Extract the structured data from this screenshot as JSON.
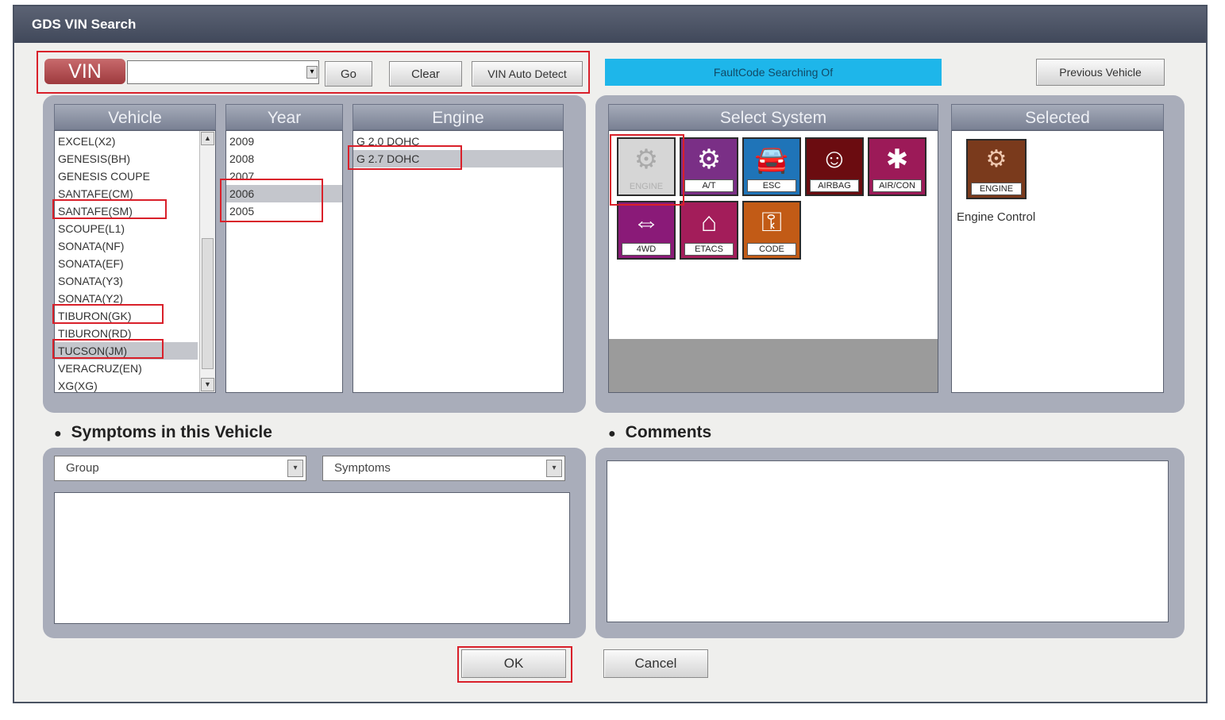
{
  "window": {
    "title": "GDS VIN Search"
  },
  "toolbar": {
    "vin_label": "VIN",
    "vin_input_value": "",
    "go_label": "Go",
    "clear_label": "Clear",
    "auto_detect_label": "VIN Auto Detect",
    "fault_status": "FaultCode Searching Of",
    "previous_vehicle_label": "Previous Vehicle"
  },
  "columns": {
    "vehicle_header": "Vehicle",
    "year_header": "Year",
    "engine_header": "Engine",
    "system_header": "Select System",
    "selected_header": "Selected"
  },
  "vehicles": [
    "EXCEL(X2)",
    "GENESIS(BH)",
    "GENESIS COUPE",
    "SANTAFE(CM)",
    "SANTAFE(SM)",
    "SCOUPE(L1)",
    "SONATA(NF)",
    "SONATA(EF)",
    "SONATA(Y3)",
    "SONATA(Y2)",
    "TIBURON(GK)",
    "TIBURON(RD)",
    "TUCSON(JM)",
    "VERACRUZ(EN)",
    "XG(XG)"
  ],
  "years": [
    "2009",
    "2008",
    "2007",
    "2006",
    "2005"
  ],
  "engines": [
    "G 2.0 DOHC",
    "G 2.7 DOHC"
  ],
  "systems": [
    {
      "label": "ENGINE",
      "icon": "engine-icon",
      "color": "#d6d6d6"
    },
    {
      "label": "A/T",
      "icon": "gears-icon",
      "color": "#7a2f86"
    },
    {
      "label": "ESC",
      "icon": "car-icon",
      "color": "#1f74b8"
    },
    {
      "label": "AIRBAG",
      "icon": "airbag-icon",
      "color": "#6b0c10"
    },
    {
      "label": "AIR/CON",
      "icon": "thermometer-icon",
      "color": "#9c1a58"
    },
    {
      "label": "4WD",
      "icon": "axle-icon",
      "color": "#8a1a78"
    },
    {
      "label": "ETACS",
      "icon": "car-outline-icon",
      "color": "#a31d5a"
    },
    {
      "label": "CODE",
      "icon": "key-icon",
      "color": "#c25b16"
    }
  ],
  "selected": {
    "label": "ENGINE",
    "caption": "Engine Control"
  },
  "symptoms": {
    "title": "Symptoms in this Vehicle",
    "group_placeholder": "Group",
    "symptoms_placeholder": "Symptoms"
  },
  "comments": {
    "title": "Comments"
  },
  "footer": {
    "ok_label": "OK",
    "cancel_label": "Cancel"
  }
}
